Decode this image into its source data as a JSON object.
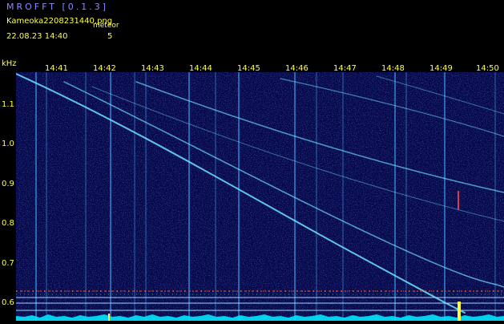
{
  "header": {
    "app_title": "MROFFT [0.1.3]",
    "file_name": "Kameoka2208231440.png",
    "meteor_label": "meteor",
    "timestamp": "22.08.23  14:40",
    "meteor_count": "5"
  },
  "axes": {
    "unit": "kHz",
    "time_ticks": [
      "14:41",
      "14:42",
      "14:43",
      "14:44",
      "14:45",
      "14:46",
      "14:47",
      "14:48",
      "14:49",
      "14:50"
    ],
    "freq_ticks": [
      "1.1",
      "1.0",
      "0.9",
      "0.8",
      "0.7",
      "0.6"
    ]
  },
  "colors": {
    "label": "#ffff3c",
    "title": "#8a8aff",
    "noise_floor": "#00e5ff",
    "background": "#05074a"
  }
}
